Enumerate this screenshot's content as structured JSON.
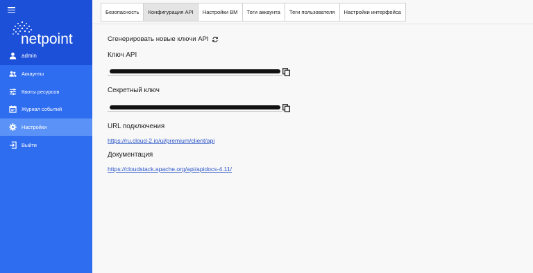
{
  "brand": {
    "logo_text": "netpoint"
  },
  "user": {
    "name": "admin"
  },
  "sidebar": {
    "items": [
      {
        "label": "Аккаунты",
        "icon": "users-icon"
      },
      {
        "label": "Квоты ресурсов",
        "icon": "sliders-icon"
      },
      {
        "label": "Журнал событий",
        "icon": "calendar-icon"
      },
      {
        "label": "Настройки",
        "icon": "gear-icon",
        "active": true
      },
      {
        "label": "Выйти",
        "icon": "logout-icon"
      }
    ]
  },
  "tabs": [
    {
      "label": "Безопасность"
    },
    {
      "label": "Конфигурация API",
      "active": true
    },
    {
      "label": "Настройки ВМ"
    },
    {
      "label": "Теги аккаунта"
    },
    {
      "label": "Теги пользователя"
    },
    {
      "label": "Настройки интерфейса"
    }
  ],
  "main": {
    "generate_label": "Сгенерировать новые ключи API",
    "api_key_label": "Ключ API",
    "secret_key_label": "Секретный ключ",
    "url_label": "URL подключения",
    "url_value": "https://ru.cloud-2.io/ui/premium/client/api",
    "docs_label": "Документация",
    "docs_value": "https://cloudstack.apache.org/api/apidocs-4.11/"
  },
  "colors": {
    "sidebar": "#2f6df0",
    "sidebar_top": "#1d50d8",
    "active_item": "#5a92f7",
    "link": "#2b55c9"
  }
}
